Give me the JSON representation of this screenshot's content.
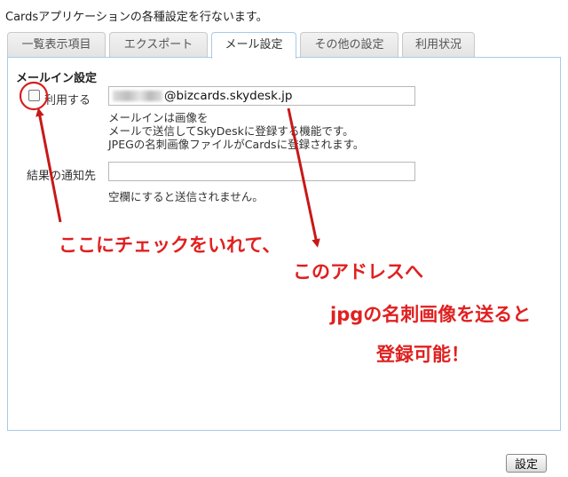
{
  "intro_text": "Cardsアプリケーションの各種設定を行ないます。",
  "tabs": [
    {
      "label": "一覧表示項目",
      "active": false
    },
    {
      "label": "エクスポート",
      "active": false
    },
    {
      "label": "メール設定",
      "active": true
    },
    {
      "label": "その他の設定",
      "active": false
    },
    {
      "label": "利用状況",
      "active": false
    }
  ],
  "mail_in": {
    "section_title": "メールイン設定",
    "checkbox_label": "利用する",
    "checkbox_checked": false,
    "email_value": "@bizcards.skydesk.jp",
    "description": [
      "メールインは画像を",
      "メールで送信してSkyDeskに登録する機能です。",
      "JPEGの名刺画像ファイルがCardsに登録されます。"
    ],
    "notify_label": "結果の通知先",
    "notify_value": "",
    "notify_note": "空欄にすると送信されません。"
  },
  "annotations": {
    "text1": "ここにチェックをいれて、",
    "text2": "このアドレスへ",
    "text3": "jpgの名刺画像を送ると",
    "text4": "登録可能！",
    "color": "#e02020"
  },
  "submit_label": "設定"
}
